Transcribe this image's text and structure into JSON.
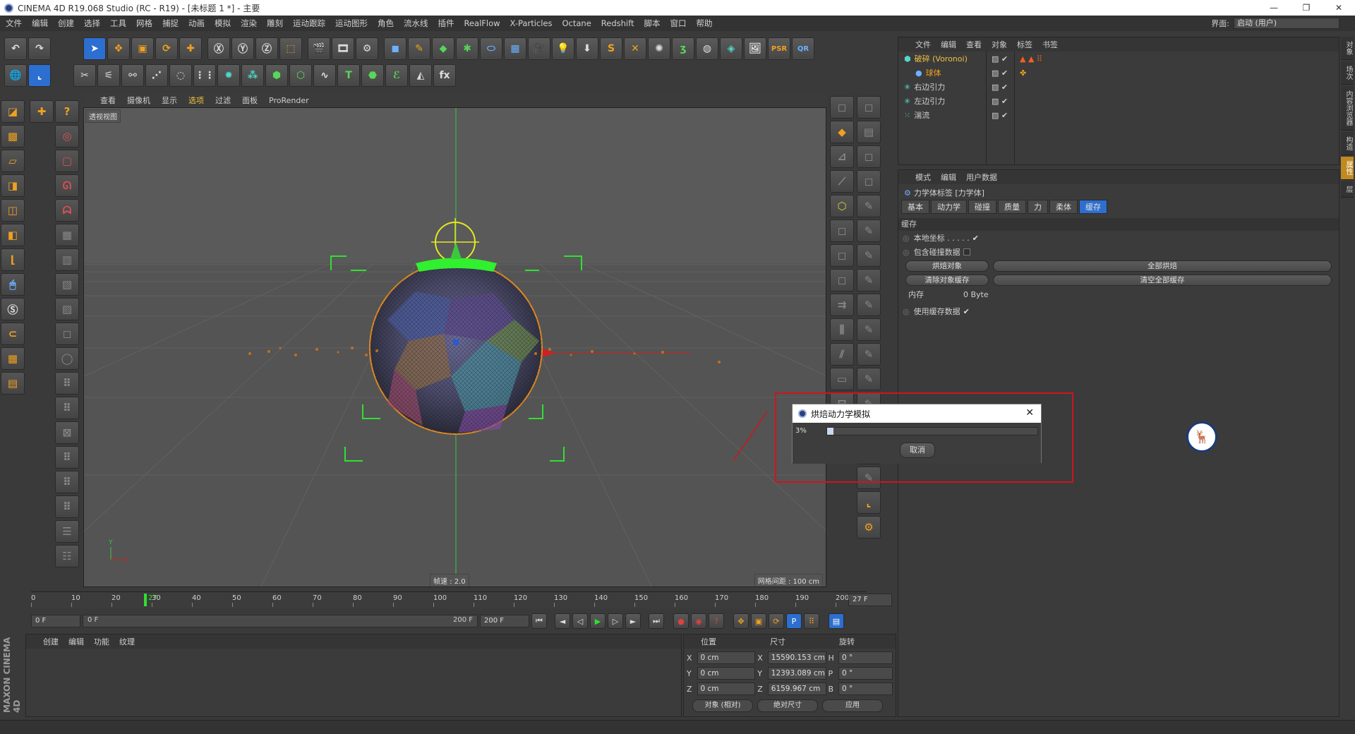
{
  "window": {
    "title": "CINEMA 4D R19.068 Studio (RC - R19) - [未标题 1 *] - 主要",
    "controls": [
      "—",
      "❐",
      "✕"
    ]
  },
  "menu": [
    "文件",
    "编辑",
    "创建",
    "选择",
    "工具",
    "网格",
    "捕捉",
    "动画",
    "模拟",
    "渲染",
    "雕刻",
    "运动跟踪",
    "运动图形",
    "角色",
    "流水线",
    "插件",
    "RealFlow",
    "X-Particles",
    "Octane",
    "Redshift",
    "脚本",
    "窗口",
    "帮助"
  ],
  "interface": {
    "label": "界面:",
    "value": "启动 (用户)"
  },
  "viewport": {
    "menu": [
      "查看",
      "摄像机",
      "显示",
      "选项",
      "过滤",
      "面板",
      "ProRender"
    ],
    "active_menu": "选项",
    "label": "透视视图",
    "fps": "帧速 : 2.0",
    "grid": "网格间距 : 100 cm",
    "axis": {
      "x": "X",
      "y": "Y"
    }
  },
  "timeline": {
    "ticks": [
      "0",
      "10",
      "20",
      "30",
      "40",
      "50",
      "60",
      "70",
      "80",
      "90",
      "100",
      "110",
      "120",
      "130",
      "140",
      "150",
      "160",
      "170",
      "180",
      "190",
      "200"
    ],
    "current": "27",
    "frame_field": "27 F"
  },
  "playback": {
    "start": "0 F",
    "range_start": "0 F",
    "range_end": "200 F",
    "end": "200 F"
  },
  "object_manager": {
    "menu": [
      "文件",
      "编辑",
      "查看",
      "对象",
      "标签",
      "书签"
    ],
    "objects": [
      {
        "name": "破碎 (Voronoi)",
        "icon": "voronoi-icon",
        "highlight": true
      },
      {
        "name": "球体",
        "icon": "sphere-icon",
        "child": true
      },
      {
        "name": "右边引力",
        "icon": "attractor-icon"
      },
      {
        "name": "左边引力",
        "icon": "attractor-icon"
      },
      {
        "name": "湍流",
        "icon": "turbulence-icon"
      }
    ]
  },
  "attributes": {
    "menu": [
      "模式",
      "编辑",
      "用户数据"
    ],
    "tag_title": "力学体标签 [力学体]",
    "tabs": [
      "基本",
      "动力学",
      "碰撞",
      "质量",
      "力",
      "柔体",
      "缓存"
    ],
    "active_tab": "缓存",
    "section": "缓存",
    "local_coords": "本地坐标 . . . . .",
    "include_collision": "包含碰撞数据",
    "bake_object": "烘焙对象",
    "bake_all": "全部烘焙",
    "clear_object_cache": "清除对象缓存",
    "clear_all_cache": "清空全部缓存",
    "memory_label": "内存",
    "memory_value": "0 Byte",
    "use_cache": "使用缓存数据"
  },
  "content_browser": {
    "menu": [
      "创建",
      "编辑",
      "功能",
      "纹理"
    ],
    "brand": "MAXON CINEMA 4D"
  },
  "coords": {
    "headers": [
      "位置",
      "尺寸",
      "旋转"
    ],
    "rows": [
      {
        "a": "X",
        "pos": "0 cm",
        "sa": "X",
        "size": "15590.153 cm",
        "ra": "H",
        "rot": "0 °"
      },
      {
        "a": "Y",
        "pos": "0 cm",
        "sa": "Y",
        "size": "12393.089 cm",
        "ra": "P",
        "rot": "0 °"
      },
      {
        "a": "Z",
        "pos": "0 cm",
        "sa": "Z",
        "size": "6159.967 cm",
        "ra": "B",
        "rot": "0 °"
      }
    ],
    "mode1": "对象 (相对)",
    "mode2": "绝对尺寸",
    "apply": "应用"
  },
  "dialog": {
    "title": "烘焙动力学模拟",
    "percent": "3%",
    "progress": 0.03,
    "cancel": "取消"
  },
  "sidetabs": [
    "对象",
    "场次",
    "内容浏览器",
    "构造",
    "属性",
    "层"
  ],
  "colors": {
    "accent": "#f0a020",
    "selection": "#2c6fd0",
    "highlight_box": "#d0141e"
  }
}
